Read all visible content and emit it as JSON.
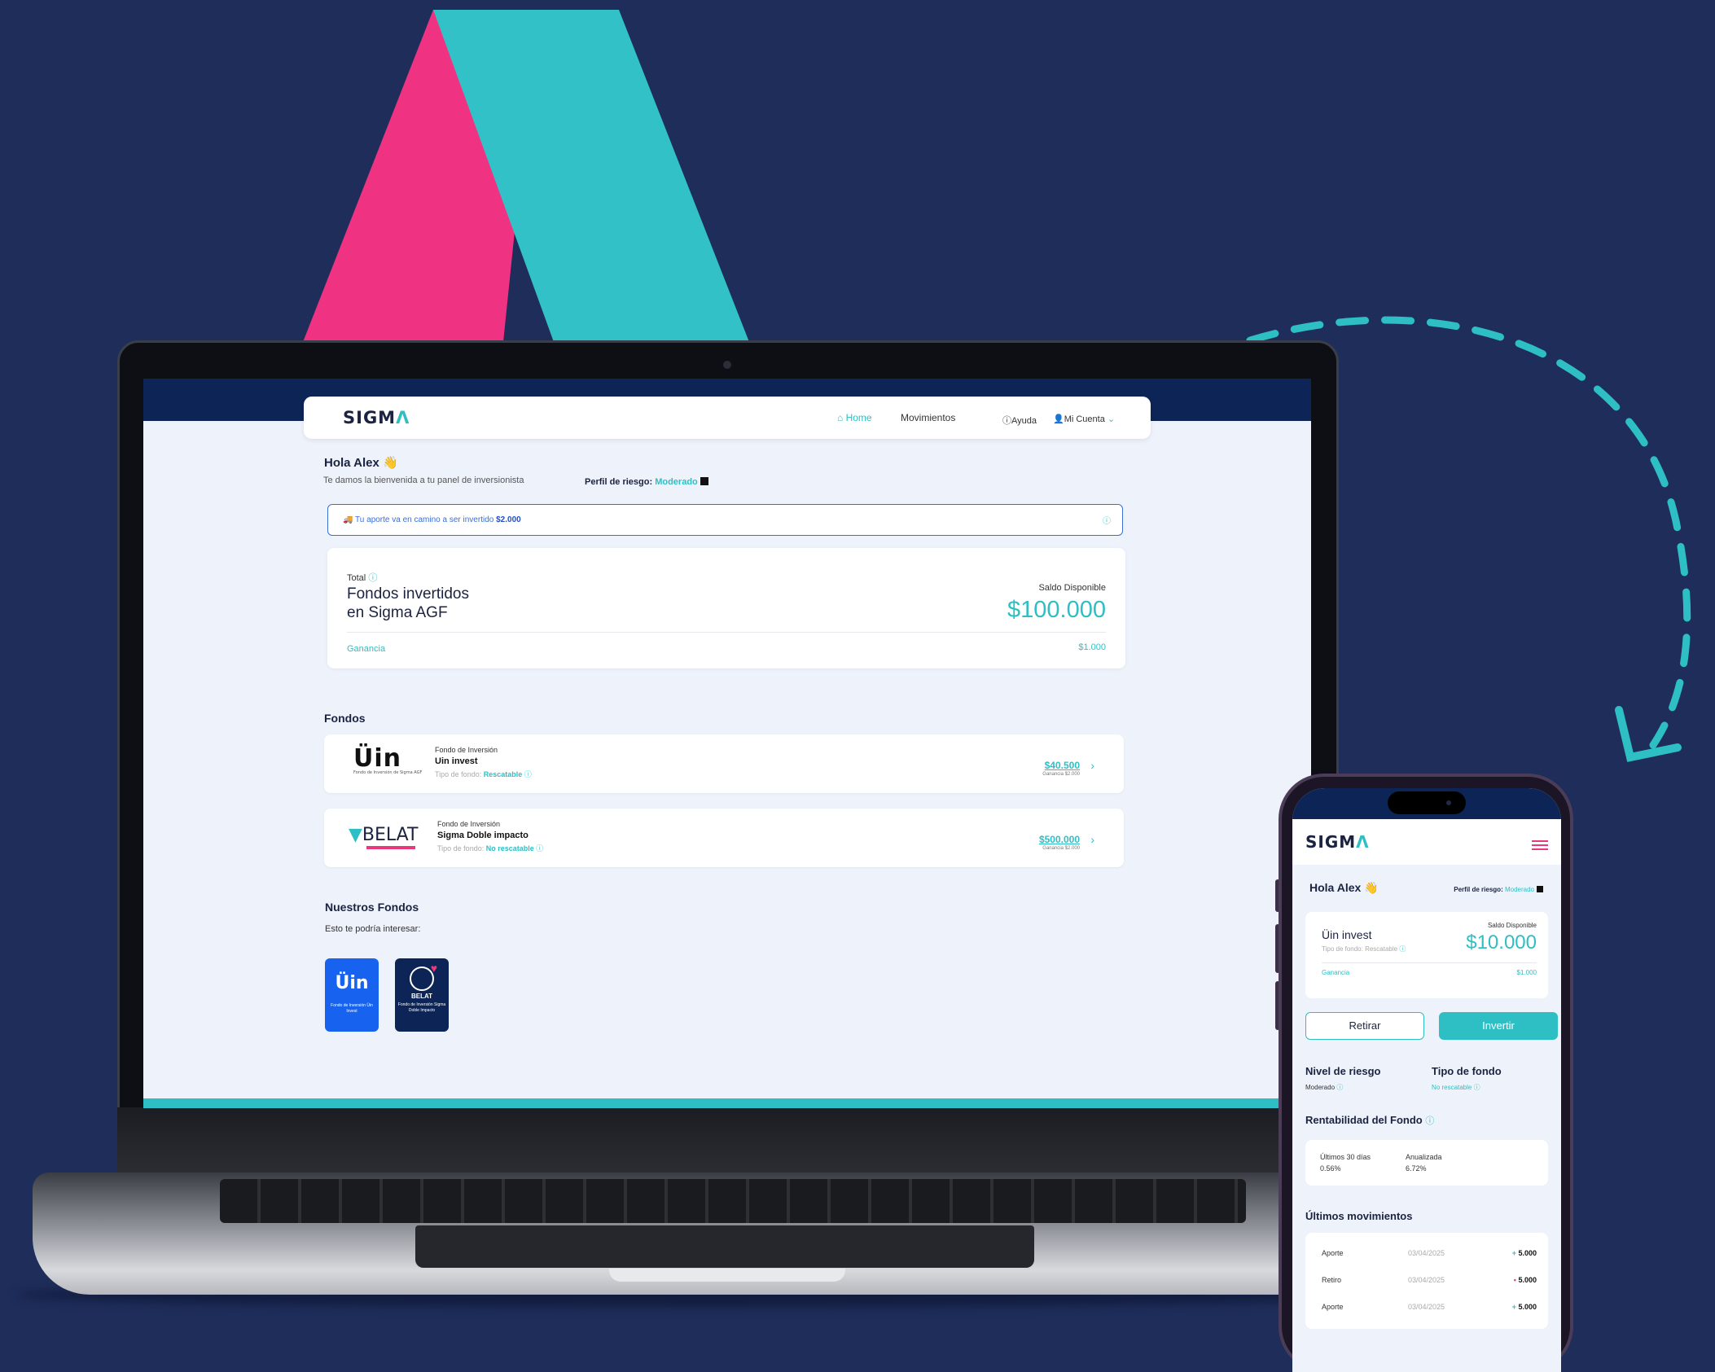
{
  "desktop": {
    "logo": "SIGM",
    "logo_accent": "Λ",
    "nav": {
      "home": "Home",
      "movimientos": "Movimientos",
      "ayuda": "Ayuda",
      "mi_cuenta": "Mi Cuenta"
    },
    "greeting": "Hola Alex 👋",
    "welcome": "Te damos la bienvenida a tu panel de inversionista",
    "risk_label": "Perfil de riesgo:",
    "risk_value": "Moderado",
    "notice": {
      "text": "🚚 Tu aporte va en camino a ser invertido",
      "amount": "$2.000"
    },
    "summary": {
      "total_label": "Total",
      "title_line1": "Fondos invertidos",
      "title_line2": "en Sigma AGF",
      "saldo_label": "Saldo Disponible",
      "saldo_value": "$100.000",
      "ganancia_label": "Ganancia",
      "ganancia_value": "$1.000"
    },
    "fondos_title": "Fondos",
    "funds": [
      {
        "logo": "Üin",
        "logo_sub": "Fondo de Inversión de Sigma AGF",
        "label": "Fondo de Inversión",
        "name": "Uin invest",
        "type_label": "Tipo de fondo:",
        "type_value": "Rescatable",
        "amount": "$40.500",
        "gain": "Ganancia $2.000"
      },
      {
        "logo": "BELAT",
        "label": "Fondo de Inversión",
        "name": "Sigma Doble impacto",
        "type_label": "Tipo de fondo:",
        "type_value": "No rescatable",
        "amount": "$500.000",
        "gain": "Ganancia $2.000"
      }
    ],
    "nuestros_title": "Nuestros Fondos",
    "interesar": "Esto te podría interesar:",
    "tiles": [
      {
        "logo": "Üin",
        "caption": "Fondo de Inversión Üin Invest"
      },
      {
        "logo": "BELAT",
        "caption": "Fondo de Inversión Sigma Doble Impacto"
      }
    ]
  },
  "mobile": {
    "logo": "SIGM",
    "logo_accent": "Λ",
    "greeting": "Hola Alex 👋",
    "risk_label": "Perfil de riesgo:",
    "risk_value": "Moderado",
    "fund_name": "Üin invest",
    "fund_type": "Tipo de fondo: Rescatable",
    "saldo_label": "Saldo Disponible",
    "saldo_value": "$10.000",
    "ganancia_label": "Ganancia",
    "ganancia_value": "$1.000",
    "btn_retirar": "Retirar",
    "btn_invertir": "Invertir",
    "nivel_label": "Nivel de riesgo",
    "nivel_value": "Moderado",
    "tipo_label": "Tipo de fondo",
    "tipo_value": "No rescatable",
    "rentabilidad_title": "Rentabilidad del Fondo",
    "rent_30_label": "Últimos 30 días",
    "rent_30_value": "0.56%",
    "rent_anual_label": "Anualizada",
    "rent_anual_value": "6.72%",
    "movimientos_title": "Últimos movimientos",
    "movimientos": [
      {
        "type": "Aporte",
        "date": "03/04/2025",
        "sign": "+",
        "amount": "5.000"
      },
      {
        "type": "Retiro",
        "date": "03/04/2025",
        "sign": "•",
        "amount": "5.000"
      },
      {
        "type": "Aporte",
        "date": "03/04/2025",
        "sign": "+",
        "amount": "5.000"
      }
    ]
  },
  "colors": {
    "background": "#1e2d5a",
    "accent_teal": "#2ebfc4",
    "accent_pink": "#f03282",
    "navy": "#0d2556"
  }
}
